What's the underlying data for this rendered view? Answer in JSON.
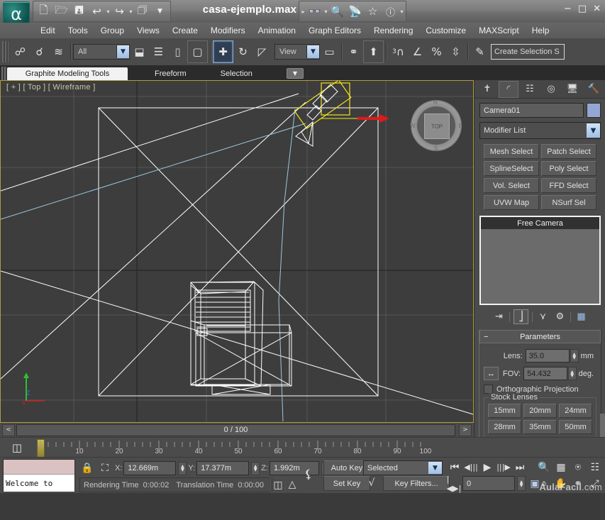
{
  "window": {
    "document_title": "casa-ejemplo.max",
    "minimize": "−",
    "maximize": "□",
    "close": "✕"
  },
  "quick_access": {
    "items": [
      {
        "name": "new-file-icon",
        "glyph": "🗋"
      },
      {
        "name": "open-file-icon",
        "glyph": "🗁"
      },
      {
        "name": "save-file-icon",
        "glyph": "🖫"
      },
      {
        "name": "undo-icon",
        "glyph": "↩"
      },
      {
        "name": "undo-dropdown-icon",
        "glyph": "▾"
      },
      {
        "name": "redo-icon",
        "glyph": "↪"
      },
      {
        "name": "redo-dropdown-icon",
        "glyph": "▾"
      },
      {
        "name": "project-folder-icon",
        "glyph": "🗇"
      },
      {
        "name": "qat-overflow-icon",
        "glyph": "▼"
      }
    ],
    "items_right": [
      {
        "name": "workspace-arrow-icon",
        "glyph": "▸"
      },
      {
        "name": "binoculars-icon",
        "glyph": "👓"
      },
      {
        "name": "binoculars-dropdown-icon",
        "glyph": "▾"
      },
      {
        "name": "wrench-icon",
        "glyph": "🔍"
      },
      {
        "name": "satellite-icon",
        "glyph": "📡"
      },
      {
        "name": "star-icon",
        "glyph": "☆"
      },
      {
        "name": "help-icon",
        "glyph": "?"
      },
      {
        "name": "help-dropdown-icon",
        "glyph": "▾"
      }
    ]
  },
  "menu": {
    "items": [
      "Edit",
      "Tools",
      "Group",
      "Views",
      "Create",
      "Modifiers",
      "Animation",
      "Graph Editors",
      "Rendering",
      "Customize",
      "MAXScript",
      "Help"
    ]
  },
  "toolbar": {
    "select_filter_value": "All",
    "reference_coord_value": "View",
    "create_selection_set_placeholder": "Create Selection S",
    "snap_num": "3",
    "buttons": [
      {
        "name": "select-link-icon",
        "glyph": "⛓"
      },
      {
        "name": "unlink-selection-icon",
        "glyph": "⛓"
      },
      {
        "name": "bind-to-space-warp-icon",
        "glyph": "≋"
      },
      {
        "name": "select-object-icon",
        "glyph": "⬓"
      },
      {
        "name": "select-by-name-icon",
        "glyph": "☰"
      },
      {
        "name": "rectangular-selection-region-icon",
        "glyph": "▭"
      },
      {
        "name": "window-crossing-icon",
        "glyph": "▣"
      },
      {
        "name": "select-and-move-icon",
        "glyph": "✛"
      },
      {
        "name": "select-and-rotate-icon",
        "glyph": "↻"
      },
      {
        "name": "select-and-scale-icon",
        "glyph": "◹"
      },
      {
        "name": "use-center-flyout-icon",
        "glyph": "▤"
      },
      {
        "name": "select-and-manipulate-icon",
        "glyph": "⚯"
      },
      {
        "name": "keyboard-shortcut-override-icon",
        "glyph": "⬆"
      },
      {
        "name": "snaps-toggle-icon",
        "glyph": "∩"
      },
      {
        "name": "angle-snap-icon",
        "glyph": "∠"
      },
      {
        "name": "percent-snap-icon",
        "glyph": "%"
      },
      {
        "name": "spinner-snap-icon",
        "glyph": "⇳"
      },
      {
        "name": "named-selection-sets-icon",
        "glyph": "✎"
      }
    ]
  },
  "ribbon": {
    "tabs": [
      "Graphite Modeling Tools",
      "Freeform",
      "Selection"
    ],
    "active_index": 0,
    "overflow_glyph": "▼"
  },
  "viewport": {
    "label": "[ + ] [ Top ] [ Wireframe ]",
    "viewcube_face": "TOP",
    "viewcube_compass": {
      "n": "N",
      "w": "W",
      "e": "E",
      "s": "S"
    },
    "axis_labels": {
      "x": "X",
      "y": "Y",
      "z": "Z"
    },
    "gizmo_axis_label": "x"
  },
  "command_panel": {
    "tabs": [
      {
        "name": "create-tab",
        "glyph": "✥"
      },
      {
        "name": "modify-tab",
        "glyph": "◜"
      },
      {
        "name": "hierarchy-tab",
        "glyph": "⛁"
      },
      {
        "name": "motion-tab",
        "glyph": "◎"
      },
      {
        "name": "display-tab",
        "glyph": "🖵"
      },
      {
        "name": "utilities-tab",
        "glyph": "🔨"
      }
    ],
    "active_tab_index": 1,
    "object_name": "Camera01",
    "object_color": "#94a6d4",
    "modifier_list_label": "Modifier List",
    "modifier_buttons": [
      "Mesh Select",
      "Patch Select",
      "SplineSelect",
      "Poly Select",
      "Vol. Select",
      "FFD Select",
      "UVW Map",
      "NSurf Sel"
    ],
    "stack_items": [
      "Free Camera"
    ],
    "stack_tools": [
      {
        "name": "pin-stack-icon",
        "glyph": "⇥"
      },
      {
        "name": "show-end-result-icon",
        "glyph": "⌶"
      },
      {
        "name": "make-unique-icon",
        "glyph": "⋎"
      },
      {
        "name": "remove-modifier-icon",
        "glyph": "♻"
      },
      {
        "name": "configure-modifier-sets-icon",
        "glyph": "▦"
      }
    ],
    "parameters": {
      "title": "Parameters",
      "collapse_glyph": "−",
      "lens_label": "Lens:",
      "lens_value": "35.0",
      "lens_unit": "mm",
      "fov_icon_name": "fov-direction-icon",
      "fov_label": "FOV:",
      "fov_value": "54.432",
      "fov_unit": "deg.",
      "ortho_label": "Orthographic Projection",
      "stock_lenses_label": "Stock Lenses",
      "stock_lenses": [
        "15mm",
        "20mm",
        "24mm",
        "28mm",
        "35mm",
        "50mm"
      ]
    }
  },
  "timebar": {
    "prev_glyph": "<",
    "next_glyph": ">",
    "frame_readout": "0 / 100",
    "ruler_ticks": [
      10,
      20,
      30,
      40,
      50,
      60,
      70,
      80,
      90,
      100
    ],
    "track_icon_name": "open-mini-curve-editor-icon"
  },
  "status": {
    "listener_text": "Welcome to",
    "lock_icon_name": "selection-lock-icon",
    "absolute_mode_icon_name": "absolute-relative-transform-icon",
    "coords": [
      {
        "label": "X:",
        "value": "12.669m"
      },
      {
        "label": "Y:",
        "value": "17.377m"
      },
      {
        "label": "Z:",
        "value": "1.992m"
      }
    ],
    "rendering_time_label": "Rendering Time",
    "rendering_time_value": "0:00:02",
    "translation_time_label": "Translation Time",
    "translation_time_value": "0:00:00",
    "grid_icon_name": "grid-toggle-icon",
    "key_mode_icon_name": "key-mode-toggle-icon",
    "auto_key_label": "Auto Key",
    "set_key_label": "Set Key",
    "selection_filter_value": "Selected",
    "curve_icon_name": "default-in-out-tangent-icon",
    "key_filters_label": "Key Filters...",
    "current_frame_value": "0",
    "playback": [
      {
        "name": "goto-start-icon",
        "glyph": "⏮"
      },
      {
        "name": "previous-frame-icon",
        "glyph": "◀|"
      },
      {
        "name": "play-animation-icon",
        "glyph": "▶"
      },
      {
        "name": "next-frame-icon",
        "glyph": "|▶"
      },
      {
        "name": "goto-end-icon",
        "glyph": "⏭"
      }
    ],
    "key_step_icon_name": "key-mode-step-icon",
    "time_config_icon_name": "time-configuration-icon",
    "nav_buttons": [
      {
        "name": "zoom-icon",
        "glyph": "🔍"
      },
      {
        "name": "zoom-all-icon",
        "glyph": "▤"
      },
      {
        "name": "zoom-extents-icon",
        "glyph": "⛶"
      },
      {
        "name": "zoom-extents-all-icon",
        "glyph": "⬚"
      },
      {
        "name": "field-of-view-icon",
        "glyph": "⬛"
      },
      {
        "name": "pan-view-icon",
        "glyph": "✋"
      },
      {
        "name": "orbit-icon",
        "glyph": "◔"
      },
      {
        "name": "maximize-viewport-toggle-icon",
        "glyph": "⤡"
      }
    ],
    "watermark": "AulaFacil",
    "watermark_suffix": ".com"
  }
}
